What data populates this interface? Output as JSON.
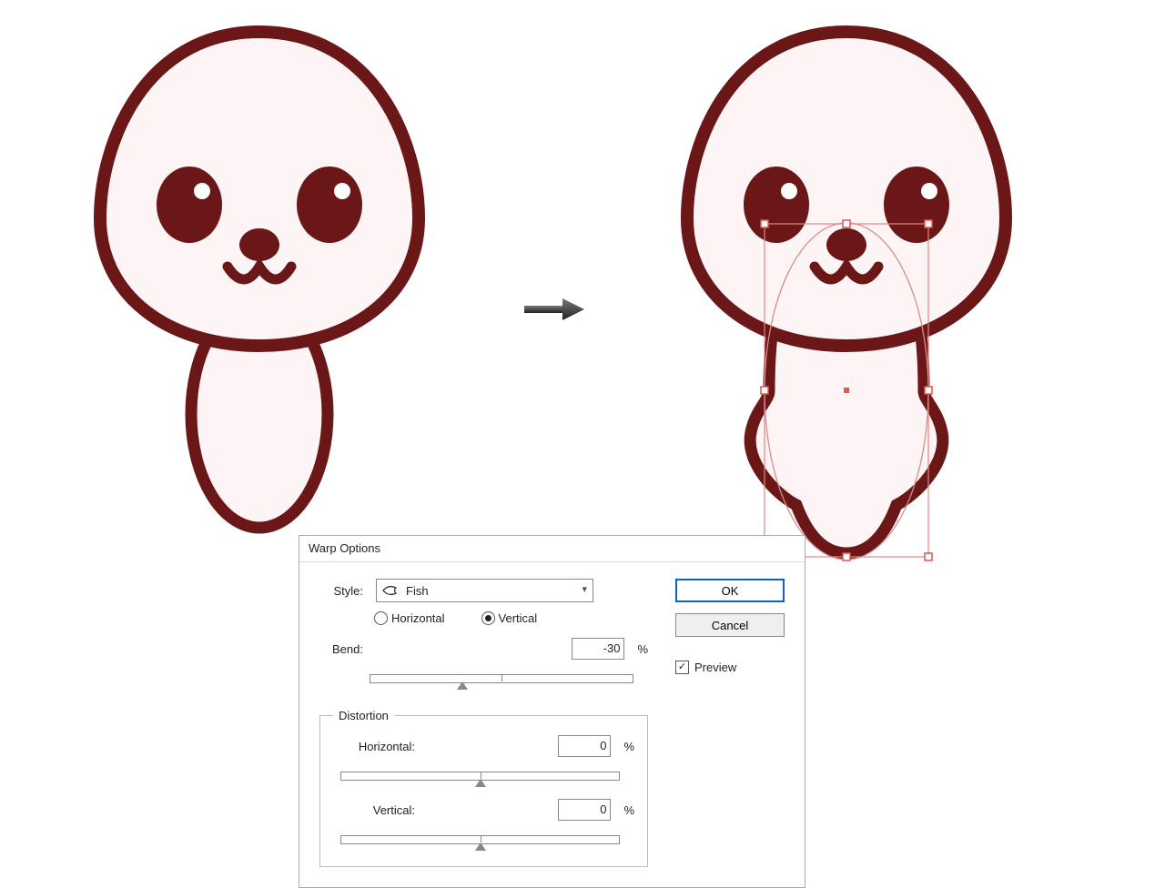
{
  "dialog": {
    "title": "Warp Options",
    "style_label": "Style:",
    "style_value": "Fish",
    "orientation": {
      "horizontal_label": "Horizontal",
      "vertical_label": "Vertical",
      "selected": "Vertical"
    },
    "bend": {
      "label": "Bend:",
      "value": "-30",
      "unit": "%"
    },
    "distortion": {
      "legend": "Distortion",
      "horizontal": {
        "label": "Horizontal:",
        "value": "0",
        "unit": "%"
      },
      "vertical": {
        "label": "Vertical:",
        "value": "0",
        "unit": "%"
      }
    },
    "ok_label": "OK",
    "cancel_label": "Cancel",
    "preview_label": "Preview",
    "preview_checked": true
  },
  "artwork": {
    "stroke_color": "#6b1718",
    "fill_color": "#fdf5f5"
  }
}
